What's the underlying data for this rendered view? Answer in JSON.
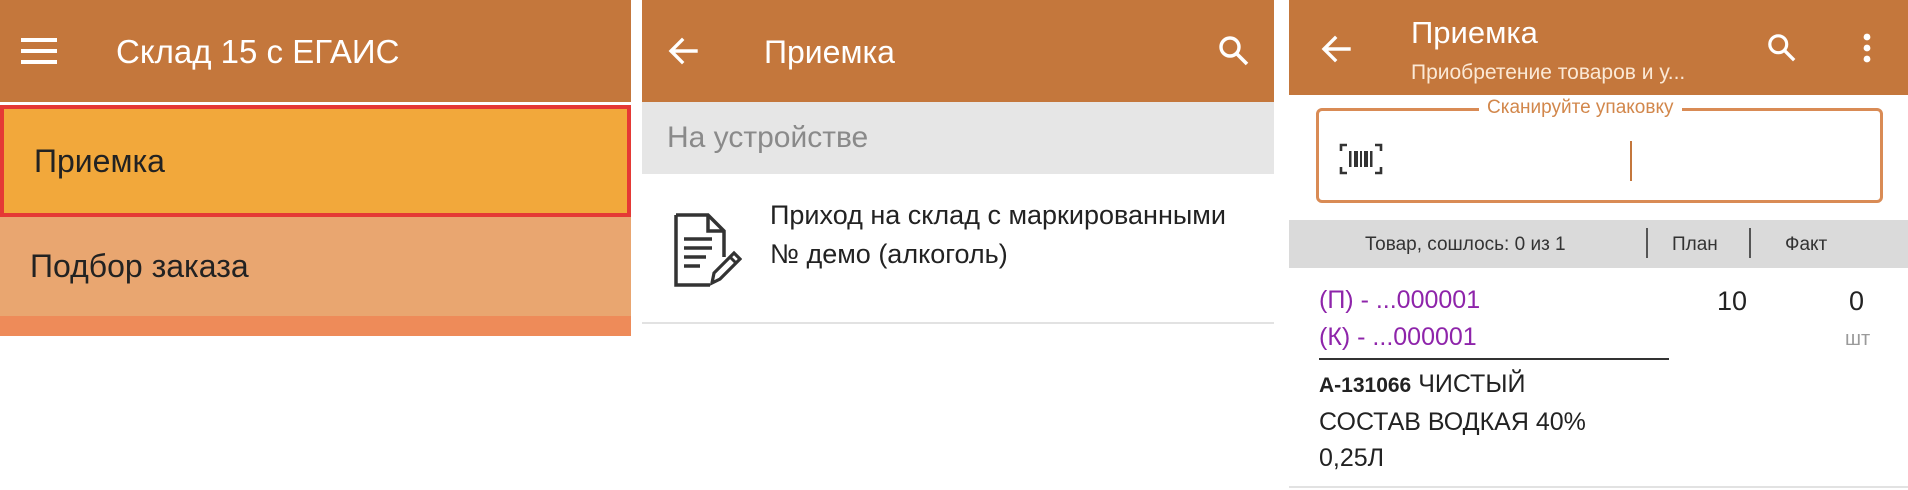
{
  "screen1": {
    "title": "Склад 15 с ЕГАИС",
    "menu": [
      "Приемка",
      "Подбор заказа"
    ],
    "selected_highlight": "#E53935"
  },
  "screen2": {
    "title": "Приемка",
    "section": "На устройстве",
    "documents": [
      {
        "title": "Приход на склад с маркированными № демо (алкоголь)"
      }
    ]
  },
  "screen3": {
    "title": "Приемка",
    "subtitle": "Приобретение товаров и у...",
    "scan_label": "Сканируйте упаковку",
    "table": {
      "col_goods": "Товар, сошлось: 0 из 1",
      "col_plan": "План",
      "col_fact": "Факт"
    },
    "item": {
      "mark_p": "(П) - ...000001",
      "mark_k": "(К) - ...000001",
      "code": "А-131066",
      "name": "ЧИСТЫЙ СОСТАВ ВОДКАЯ 40% 0,25Л",
      "plan": "10",
      "fact": "0",
      "unit": "шт"
    }
  },
  "colors": {
    "appbar": "#C4773C",
    "selected": "#F2A83B",
    "menu_item": "#E9A670",
    "mark_text": "#8E24AA"
  }
}
